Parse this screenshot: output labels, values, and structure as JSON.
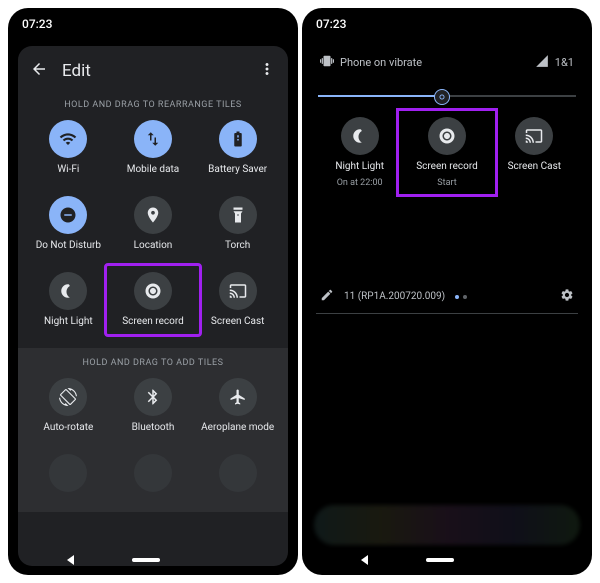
{
  "left": {
    "time": "07:23",
    "title": "Edit",
    "hint_rearrange": "HOLD AND DRAG TO REARRANGE TILES",
    "hint_add": "HOLD AND DRAG TO ADD TILES",
    "tiles_active": [
      {
        "label": "Wi-Fi"
      },
      {
        "label": "Mobile data"
      },
      {
        "label": "Battery Saver"
      },
      {
        "label": "Do Not Disturb"
      },
      {
        "label": "Location"
      },
      {
        "label": "Torch"
      },
      {
        "label": "Night Light"
      },
      {
        "label": "Screen record"
      },
      {
        "label": "Screen Cast"
      }
    ],
    "tiles_inactive": [
      {
        "label": "Auto-rotate"
      },
      {
        "label": "Bluetooth"
      },
      {
        "label": "Aeroplane mode"
      }
    ]
  },
  "right": {
    "time": "07:23",
    "phone_status": "Phone on vibrate",
    "signal_label": "1&1",
    "tiles": [
      {
        "label": "Night Light",
        "sublabel": "On at 22:00"
      },
      {
        "label": "Screen record",
        "sublabel": "Start"
      },
      {
        "label": "Screen Cast",
        "sublabel": ""
      }
    ],
    "build": "11 (RP1A.200720.009)"
  },
  "colors": {
    "accent": "#8ab4f8",
    "highlight": "#a020f0",
    "bg_panel": "#202124",
    "tile_inactive": "#3c4043"
  }
}
